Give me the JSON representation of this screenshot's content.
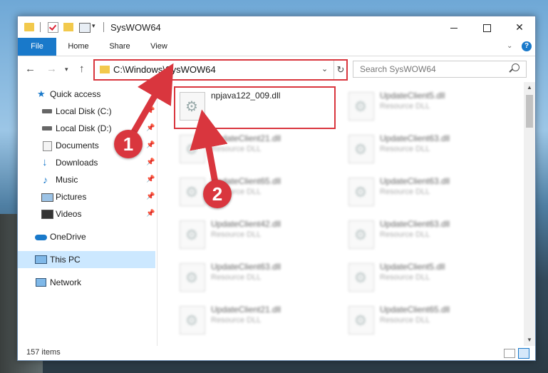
{
  "window": {
    "title": "SysWOW64",
    "controls": {
      "minimize": "minimize-icon",
      "maximize": "maximize-icon",
      "close": "✕"
    }
  },
  "ribbon": {
    "tabs": [
      "File",
      "Home",
      "Share",
      "View"
    ],
    "help": "?"
  },
  "address": {
    "path": "C:\\Windows\\SysWOW64",
    "search_placeholder": "Search SysWOW64"
  },
  "nav_pane": {
    "items": [
      {
        "label": "Quick access",
        "icon": "star-icon"
      },
      {
        "label": "Local Disk (C:)",
        "icon": "drive-icon",
        "pinned": true
      },
      {
        "label": "Local Disk (D:)",
        "icon": "drive-icon",
        "pinned": true
      },
      {
        "label": "Documents",
        "icon": "documents-icon",
        "pinned": true
      },
      {
        "label": "Downloads",
        "icon": "download-icon",
        "pinned": true
      },
      {
        "label": "Music",
        "icon": "music-icon",
        "pinned": true
      },
      {
        "label": "Pictures",
        "icon": "pictures-icon",
        "pinned": true
      },
      {
        "label": "Videos",
        "icon": "videos-icon",
        "pinned": true
      },
      {
        "label": "OneDrive",
        "icon": "cloud-icon"
      },
      {
        "label": "This PC",
        "icon": "computer-icon",
        "selected": true
      },
      {
        "label": "Network",
        "icon": "network-icon"
      }
    ]
  },
  "files": [
    {
      "name": "npjava122_009.dll",
      "type": ""
    },
    {
      "name": "UpdateClient5.dll",
      "type": "Resource DLL"
    },
    {
      "name": "UpdateClient21.dll",
      "type": "Resource DLL"
    },
    {
      "name": "UpdateClient63.dll",
      "type": "Resource DLL"
    },
    {
      "name": "UpdateClient65.dll",
      "type": "Resource DLL"
    },
    {
      "name": "UpdateClient63.dll",
      "type": "Resource DLL"
    },
    {
      "name": "UpdateClient42.dll",
      "type": "Resource DLL"
    },
    {
      "name": "UpdateClient63.dll",
      "type": "Resource DLL"
    },
    {
      "name": "UpdateClient63.dll",
      "type": "Resource DLL"
    },
    {
      "name": "UpdateClient5.dll",
      "type": "Resource DLL"
    },
    {
      "name": "UpdateClient21.dll",
      "type": "Resource DLL"
    },
    {
      "name": "UpdateClient65.dll",
      "type": "Resource DLL"
    }
  ],
  "status": {
    "item_count": "157 items"
  },
  "annotations": {
    "badge1": "1",
    "badge2": "2",
    "color": "#d9363e"
  }
}
